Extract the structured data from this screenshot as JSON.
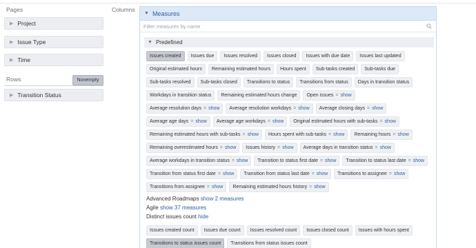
{
  "sidebar": {
    "pages_title": "Pages",
    "pages": [
      {
        "label": "Project"
      },
      {
        "label": "Issue Type"
      },
      {
        "label": "Time"
      }
    ],
    "rows_title": "Rows",
    "nonempty_label": "Nonempty",
    "rows": [
      {
        "label": "Transition Status"
      }
    ]
  },
  "columns": {
    "title": "Columns",
    "panel_title": "Measures",
    "filter_placeholder": "Filter measures by name",
    "predefined_label": "Predefined",
    "measures": [
      {
        "label": "Issues created",
        "selected": true
      },
      {
        "label": "Issues due"
      },
      {
        "label": "Issues resolved"
      },
      {
        "label": "Issues closed"
      },
      {
        "label": "Issues with due date"
      },
      {
        "label": "Issues last updated"
      },
      {
        "label": "Original estimated hours"
      },
      {
        "label": "Remaining estimated hours"
      },
      {
        "label": "Hours spent"
      },
      {
        "label": "Sub-tasks created"
      },
      {
        "label": "Sub-tasks due"
      },
      {
        "label": "Sub-tasks resolved"
      },
      {
        "label": "Sub-tasks closed"
      },
      {
        "label": "Transitions to status"
      },
      {
        "label": "Transitions from status"
      },
      {
        "label": "Days in transition status"
      },
      {
        "label": "Workdays in transition status"
      },
      {
        "label": "Remaining estimated hours change"
      },
      {
        "label": "Open issues",
        "show": "show"
      },
      {
        "label": "Average resolution days",
        "show": "show"
      },
      {
        "label": "Average resolution workdays",
        "show": "show"
      },
      {
        "label": "Average closing days",
        "show": "show"
      },
      {
        "label": "Average age days",
        "show": "show"
      },
      {
        "label": "Average age workdays",
        "show": "show"
      },
      {
        "label": "Original estimated hours with sub-tasks",
        "show": "show"
      },
      {
        "label": "Remaining estimated hours with sub-tasks",
        "show": "show"
      },
      {
        "label": "Hours spent with sub-tasks",
        "show": "show"
      },
      {
        "label": "Remaining hours",
        "show": "show"
      },
      {
        "label": "Remaining overestimated hours",
        "show": "show"
      },
      {
        "label": "Issues history",
        "show": "show"
      },
      {
        "label": "Average days in transition status",
        "show": "show"
      },
      {
        "label": "Average workdays in transition status",
        "show": "show"
      },
      {
        "label": "Transition to status first date",
        "show": "show"
      },
      {
        "label": "Transition to status last date",
        "show": "show"
      },
      {
        "label": "Transition from status first date",
        "show": "show"
      },
      {
        "label": "Transition from status last date",
        "show": "show"
      },
      {
        "label": "Transitions to assignee",
        "show": "show"
      },
      {
        "label": "Transitions from assignee",
        "show": "show"
      },
      {
        "label": "Remaining estimated hours history",
        "show": "show"
      }
    ],
    "advanced_roadmaps": {
      "label": "Advanced Roadmaps",
      "link": "show 2 measures"
    },
    "agile": {
      "label": "Agile",
      "link": "show 37 measures"
    },
    "distinct": {
      "label": "Distinct issues count",
      "link": "hide"
    },
    "distinct_measures": [
      {
        "label": "Issues created count"
      },
      {
        "label": "Issues due count"
      },
      {
        "label": "Issues resolved count"
      },
      {
        "label": "Issues closed count"
      },
      {
        "label": "Issues with hours spent"
      },
      {
        "label": "Transitions to status issues count",
        "selected": true
      },
      {
        "label": "Transitions from status issues count"
      }
    ]
  },
  "colors": {
    "accent": "#2f5f9c",
    "panel_header": "#dde9f7",
    "chip": "#eef0f3",
    "chip_selected": "#c7cbd1"
  },
  "icons": {
    "expand": "chevron-right-icon",
    "collapse": "chevron-down-icon",
    "search": "search-icon"
  }
}
